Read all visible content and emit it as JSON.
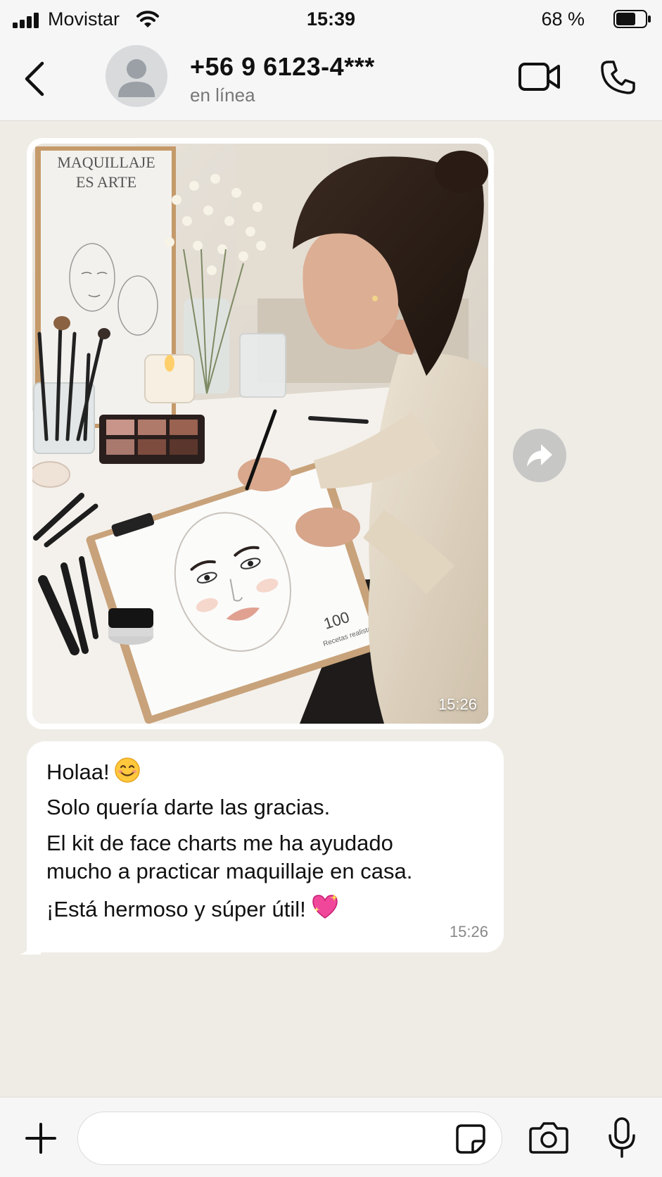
{
  "status_bar": {
    "carrier": "Movistar",
    "time": "15:39",
    "battery_percent": "68 %",
    "battery_level": 0.68
  },
  "header": {
    "contact_name": "+56 9 6123-4***",
    "contact_status": "en línea"
  },
  "messages": {
    "image_message": {
      "time": "15:26",
      "photo_texts": {
        "poster_title_1": "MAQUILLAJE",
        "poster_title_2": "ES ARTE",
        "chart_number": "100",
        "chart_caption": "Recetas realistas"
      }
    },
    "text_message": {
      "lines": [
        "Holaa!",
        "Solo quería darte las gracias.",
        "El kit de face charts me ha ayudado",
        "mucho a practicar maquillaje en casa.",
        "¡Está hermoso y súper útil!"
      ],
      "emoji_1": "smiling-face-emoji",
      "emoji_2": "sparkling-heart-emoji",
      "time": "15:26"
    }
  },
  "input_bar": {
    "placeholder": ""
  },
  "colors": {
    "chat_background": "#efece6",
    "bar_background": "#f6f6f6",
    "bubble": "#ffffff",
    "secondary_text": "#777777"
  }
}
